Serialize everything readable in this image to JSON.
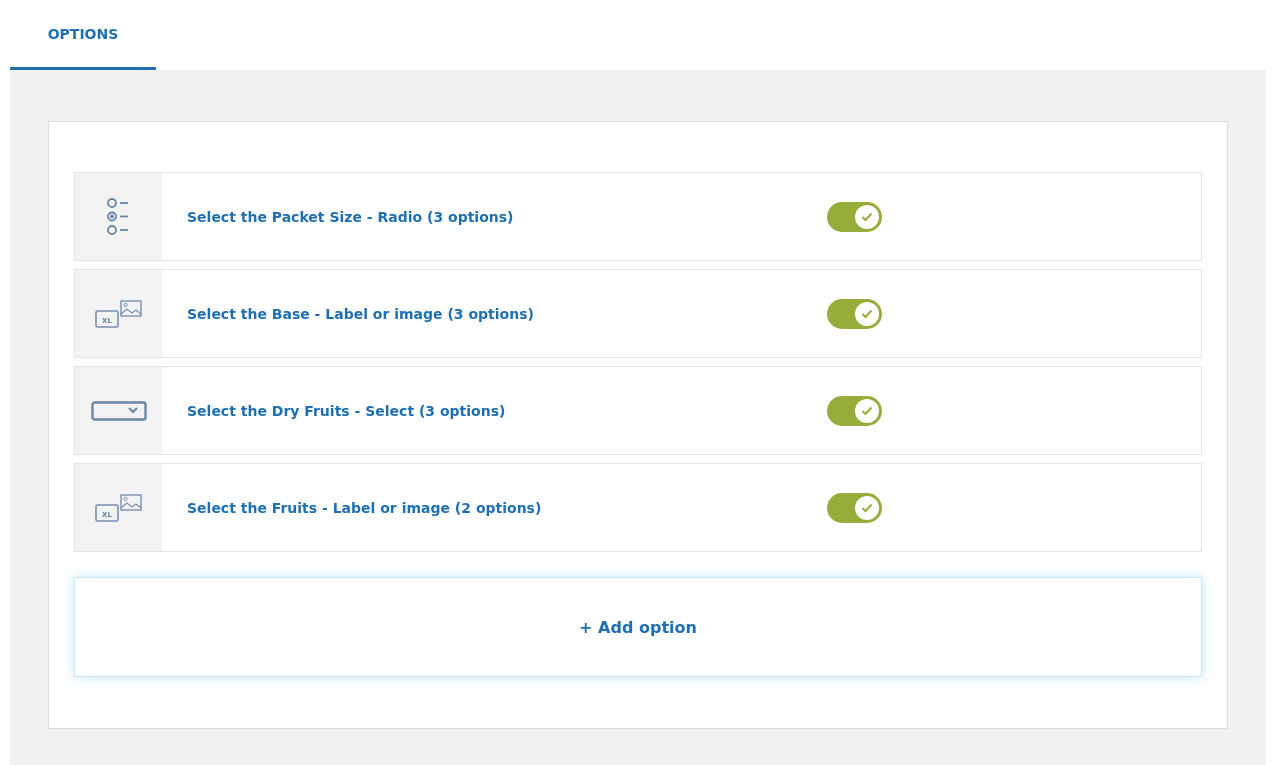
{
  "tabs": [
    {
      "label": "OPTIONS",
      "selected": true
    }
  ],
  "options": [
    {
      "kind": "radio",
      "title": "Select the Packet Size - Radio (3 options)",
      "on": true
    },
    {
      "kind": "label_image",
      "icon_text": "XL",
      "title": "Select the Base - Label or image (3 options)",
      "on": true
    },
    {
      "kind": "select",
      "title": "Select the Dry Fruits - Select (3 options)",
      "on": true
    },
    {
      "kind": "label_image",
      "icon_text": "XL",
      "title": "Select the Fruits - Label or image (2 options)",
      "on": true
    }
  ],
  "add_button": "+ Add option"
}
